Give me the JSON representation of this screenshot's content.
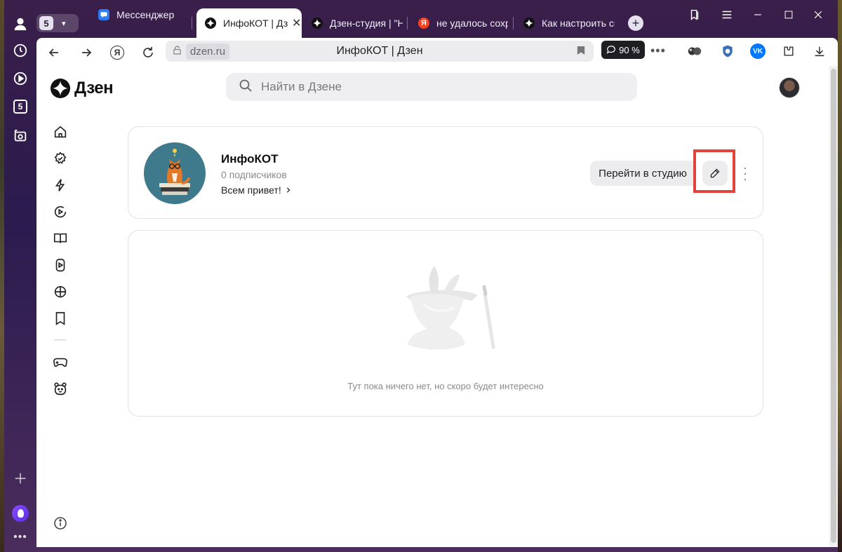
{
  "browser": {
    "tab_count": "5",
    "tabs": [
      {
        "label": "Мессенджер",
        "active": false
      },
      {
        "label": "ИнфоКОТ | Дзе",
        "active": true
      },
      {
        "label": "Дзен-студия | \"Не",
        "active": false
      },
      {
        "label": "не удалось сохра",
        "active": false
      },
      {
        "label": "Как настроить сво",
        "active": false
      }
    ],
    "address_domain": "dzen.ru",
    "page_title": "ИнфоКОТ | Дзен",
    "zoom": "90 %",
    "sidebar_count": "5"
  },
  "site": {
    "logo_text": "Дзен",
    "search_placeholder": "Найти в Дзене"
  },
  "channel": {
    "name": "ИнфоКОТ",
    "subscribers": "0 подписчиков",
    "description": "Всем привет!",
    "studio_button": "Перейти в студию"
  },
  "feed": {
    "empty_message": "Тут пока ничего нет, но скоро будет интересно"
  },
  "colors": {
    "highlight": "#e0443c",
    "avatar_bg": "#3e7a8c",
    "zoom_bg": "#1f1f23"
  }
}
